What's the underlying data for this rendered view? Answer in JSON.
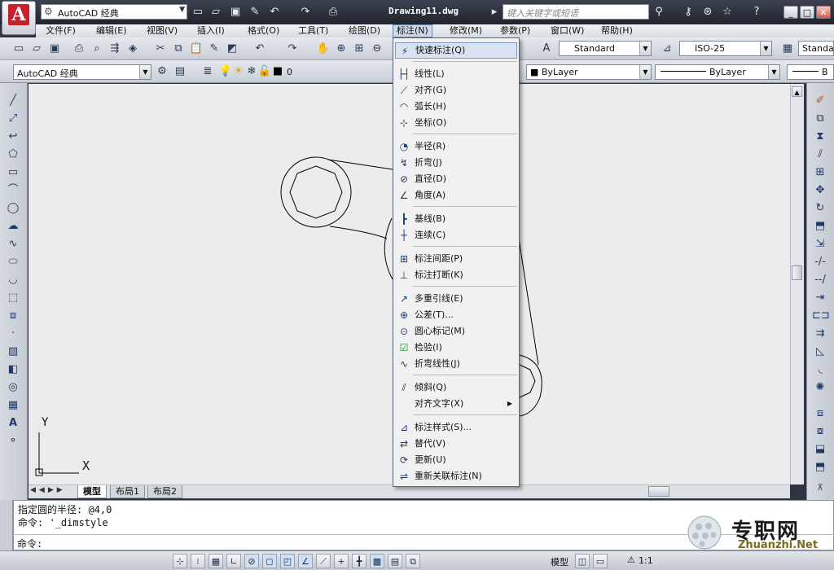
{
  "title_bar": {
    "workspace": "AutoCAD 经典",
    "document_title": "Drawing11.dwg",
    "search_placeholder": "键入关键字或短语"
  },
  "menu_bar": {
    "items": [
      "文件(F)",
      "编辑(E)",
      "视图(V)",
      "插入(I)",
      "格式(O)",
      "工具(T)",
      "绘图(D)",
      "标注(N)",
      "修改(M)",
      "参数(P)",
      "窗口(W)",
      "帮助(H)"
    ],
    "active": "标注(N)"
  },
  "toolbar_styles": {
    "text_style": "Standard",
    "dim_style": "ISO-25",
    "table_style": "Standa"
  },
  "toolbar_layers": {
    "workspace_combo": "AutoCAD 经典",
    "layer_value": "0",
    "color": "ByLayer",
    "linetype": "ByLayer",
    "lineweight": "B"
  },
  "dimension_menu": {
    "items": [
      {
        "label": "快速标注(Q)",
        "icon": "quick-dim-icon",
        "hover": true
      },
      {
        "label": "线性(L)",
        "icon": "linear-dim-icon"
      },
      {
        "label": "对齐(G)",
        "icon": "aligned-dim-icon"
      },
      {
        "label": "弧长(H)",
        "icon": "arc-length-icon"
      },
      {
        "label": "坐标(O)",
        "icon": "ordinate-icon"
      },
      {
        "label": "半径(R)",
        "icon": "radius-icon"
      },
      {
        "label": "折弯(J)",
        "icon": "jogged-icon"
      },
      {
        "label": "直径(D)",
        "icon": "diameter-icon"
      },
      {
        "label": "角度(A)",
        "icon": "angular-icon"
      },
      {
        "label": "基线(B)",
        "icon": "baseline-icon"
      },
      {
        "label": "连续(C)",
        "icon": "continue-icon"
      },
      {
        "label": "标注间距(P)",
        "icon": "dim-space-icon"
      },
      {
        "label": "标注打断(K)",
        "icon": "dim-break-icon"
      },
      {
        "label": "多重引线(E)",
        "icon": "multileader-icon"
      },
      {
        "label": "公差(T)...",
        "icon": "tolerance-icon"
      },
      {
        "label": "圆心标记(M)",
        "icon": "center-mark-icon"
      },
      {
        "label": "检验(I)",
        "icon": "inspect-icon"
      },
      {
        "label": "折弯线性(J)",
        "icon": "jogged-linear-icon"
      },
      {
        "label": "倾斜(Q)",
        "icon": "oblique-icon"
      },
      {
        "label": "对齐文字(X)",
        "icon": "",
        "submenu": true
      },
      {
        "label": "标注样式(S)...",
        "icon": "dim-style-icon"
      },
      {
        "label": "替代(V)",
        "icon": "override-icon"
      },
      {
        "label": "更新(U)",
        "icon": "update-icon"
      },
      {
        "label": "重新关联标注(N)",
        "icon": "reassociate-icon"
      }
    ]
  },
  "layout_tabs": {
    "model": "模型",
    "layout1": "布局1",
    "layout2": "布局2"
  },
  "command_window": {
    "line1": "指定圆的半径: @4,0",
    "line2": "命令: '_dimstyle",
    "prompt": "命令:"
  },
  "status_bar": {
    "model_label": "模型",
    "scale": "1:1"
  },
  "axis": {
    "x": "X",
    "y": "Y"
  },
  "watermark": {
    "cn": "专职网",
    "en": "Zhuanzhi.Net"
  }
}
